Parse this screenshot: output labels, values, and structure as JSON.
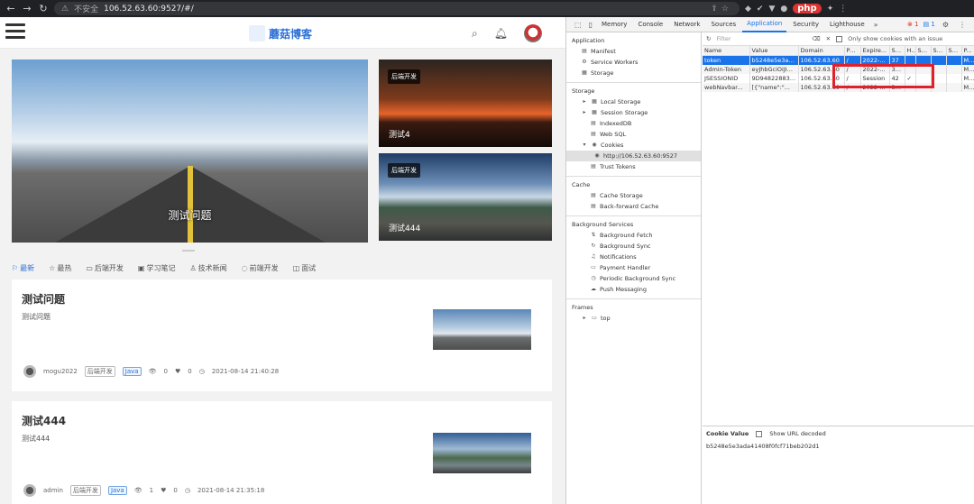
{
  "browser": {
    "insecure_label": "不安全",
    "url": "106.52.63.60:9527/#/",
    "ext_php": "php"
  },
  "blog": {
    "logo_text": "蘑菇博客",
    "hero": {
      "caption": "测试问题"
    },
    "side_cards": [
      {
        "tag": "后端开发",
        "caption": "测试4"
      },
      {
        "tag": "后端开发",
        "caption": "测试444"
      }
    ],
    "tabs": [
      {
        "label": "最新",
        "icon": "bookmark-icon"
      },
      {
        "label": "最热",
        "icon": "star-icon"
      },
      {
        "label": "后端开发",
        "icon": "monitor-icon"
      },
      {
        "label": "学习笔记",
        "icon": "camera-icon"
      },
      {
        "label": "技术新闻",
        "icon": "news-icon"
      },
      {
        "label": "前端开发",
        "icon": "chat-icon"
      },
      {
        "label": "面试",
        "icon": "box-icon"
      }
    ],
    "posts": [
      {
        "title": "测试问题",
        "summary": "测试问题",
        "author": "mogu2022",
        "category": "后端开发",
        "tag": "Java",
        "views": "0",
        "likes": "0",
        "time": "2021-08-14 21:40:28"
      },
      {
        "title": "测试444",
        "summary": "测试444",
        "author": "admin",
        "category": "后端开发",
        "tag": "Java",
        "views": "1",
        "likes": "0",
        "time": "2021-08-14 21:35:18"
      }
    ]
  },
  "devtools": {
    "tabs": [
      "Memory",
      "Console",
      "Network",
      "Sources",
      "Application",
      "Security",
      "Lighthouse"
    ],
    "active_tab": "Application",
    "error_count": "1",
    "message_count": "1",
    "sidebar": {
      "application_header": "Application",
      "application_items": [
        "Manifest",
        "Service Workers",
        "Storage"
      ],
      "storage_header": "Storage",
      "storage_items": [
        "Local Storage",
        "Session Storage",
        "IndexedDB",
        "Web SQL",
        "Cookies"
      ],
      "cookie_origin": "http://106.52.63.60:9527",
      "trust_tokens": "Trust Tokens",
      "cache_header": "Cache",
      "cache_items": [
        "Cache Storage",
        "Back-forward Cache"
      ],
      "bg_header": "Background Services",
      "bg_items": [
        "Background Fetch",
        "Background Sync",
        "Notifications",
        "Payment Handler",
        "Periodic Background Sync",
        "Push Messaging"
      ],
      "frames_header": "Frames",
      "frames_item": "top"
    },
    "filter": {
      "placeholder": "Filter",
      "only_issue_label": "Only show cookies with an issue"
    },
    "table": {
      "headers": [
        "Name",
        "Value",
        "Domain",
        "Path",
        "Expire...",
        "Size",
        "H...",
        "Se...",
        "Sa...",
        "Sa...",
        "P..."
      ],
      "rows": [
        [
          "token",
          "b5248e5e3ad...",
          "106.52.63.60",
          "/",
          "2022-...",
          "37",
          "",
          "",
          "",
          "",
          "M..."
        ],
        [
          "Admin-Token",
          "eyJhbGciOiJI...",
          "106.52.63.60",
          "/",
          "2022-...",
          "374",
          "",
          "",
          "",
          "",
          "M..."
        ],
        [
          "JSESSIONID",
          "9D948228830...",
          "106.52.63.60",
          "/",
          "Session",
          "42",
          "✓",
          "",
          "",
          "",
          "M..."
        ],
        [
          "webNavbar...",
          "[{\"name\":\"...",
          "106.52.63.60",
          "/",
          "2022-...",
          "36...",
          "",
          "",
          "",
          "",
          "M..."
        ]
      ]
    },
    "cookie_value": {
      "label": "Cookie Value",
      "show_decoded": "Show URL decoded",
      "value": "b5248e5e3ada41408f0fcf71beb202d1"
    }
  }
}
